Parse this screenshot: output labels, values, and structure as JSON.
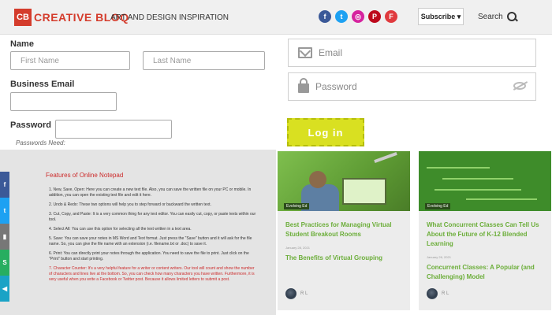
{
  "header": {
    "logo_mark": "CB",
    "logo_text": "CREATIVE BLOQ",
    "tagline": "ART AND DESIGN INSPIRATION",
    "socials": [
      "f",
      "t",
      "◎",
      "P",
      "F"
    ],
    "social_icons": [
      "facebook-icon",
      "twitter-icon",
      "instagram-icon",
      "pinterest-icon",
      "flipboard-icon"
    ],
    "subscribe_label": "Subscribe ▾",
    "search_label": "Search"
  },
  "signup_form": {
    "name_label": "Name",
    "first_name_placeholder": "First Name",
    "last_name_placeholder": "Last Name",
    "email_label": "Business Email",
    "password_label": "Password",
    "password_hint": "Passwords Need:"
  },
  "login_form": {
    "email_placeholder": "Email",
    "password_placeholder": "Password",
    "login_label": "Log in"
  },
  "notepad": {
    "title": "Features of Online Notepad",
    "items": [
      "1. New, Save, Open: Here you can create a new text file. Also, you can save the written file on your PC or mobile. In addition, you can open the existing text file and edit it here.",
      "2. Undo & Redo: These two options will help you to step forward or backward the written text.",
      "3. Cut, Copy, and Paste: It is a very common thing for any text editor. You can easily cut, copy, or paste texts within our tool.",
      "4. Select All: You can use this option for selecting all the text written in a text area.",
      "5. Save: You can save your notes in MS Word and Text format. Just press the \"Save\" button and it will ask for the file name. So, you can give the file name with an extension (i.e. filename.txt or .doc) to save it.",
      "6. Print: You can directly print your notes through the application. You need to save the file to print. Just click on the \"Print\" button and start printing.",
      "7. Character Counter: It's a very helpful feature for a writer or content writers. Our tool will count and show the number of characters and lines live at the bottom. So, you can check how many characters you have written. Furthermore, it is very useful when you write a Facebook or Twitter post. Because it allows limited letters to submit a post."
    ],
    "share_icons": [
      "f",
      "t",
      "▮",
      "S",
      "◀"
    ]
  },
  "cards": [
    {
      "tag": "Evolving Ed",
      "title": "Best Practices for Managing Virtual Student Breakout Rooms",
      "date": "January 28, 2021",
      "subtitle": "The Benefits of Virtual Grouping",
      "author": "R L"
    },
    {
      "tag": "Evolving Ed",
      "title": "What Concurrent Classes Can Tell Us About the Future of K-12 Blended Learning",
      "date": "January 26, 2021",
      "subtitle": "Concurrent Classes: A Popular (and Challenging) Model",
      "author": "R L"
    }
  ],
  "colors": {
    "brand": "#d43c2c",
    "login_button": "#d9e021",
    "card_title": "#6cae3a",
    "notepad_red": "#cc2b2b"
  }
}
